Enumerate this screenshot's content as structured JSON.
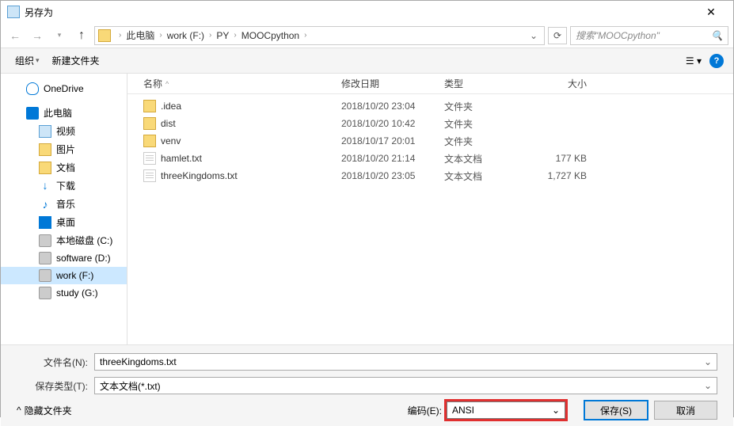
{
  "window": {
    "title": "另存为"
  },
  "breadcrumb": {
    "items": [
      "此电脑",
      "work (F:)",
      "PY",
      "MOOCpython"
    ]
  },
  "search": {
    "placeholder": "搜索\"MOOCpython\""
  },
  "toolbar": {
    "organize": "组织",
    "new_folder": "新建文件夹"
  },
  "sidebar": {
    "items": [
      {
        "label": "OneDrive",
        "icon": "cloud",
        "level": 0
      },
      {
        "label": "此电脑",
        "icon": "pc",
        "level": 0
      },
      {
        "label": "视频",
        "icon": "video",
        "level": 1
      },
      {
        "label": "图片",
        "icon": "folder",
        "level": 1
      },
      {
        "label": "文档",
        "icon": "folder",
        "level": 1
      },
      {
        "label": "下载",
        "icon": "down",
        "level": 1
      },
      {
        "label": "音乐",
        "icon": "music",
        "level": 1
      },
      {
        "label": "桌面",
        "icon": "desktop",
        "level": 1
      },
      {
        "label": "本地磁盘 (C:)",
        "icon": "disk",
        "level": 1
      },
      {
        "label": "software (D:)",
        "icon": "disk",
        "level": 1
      },
      {
        "label": "work (F:)",
        "icon": "disk",
        "level": 1,
        "selected": true
      },
      {
        "label": "study (G:)",
        "icon": "disk",
        "level": 1
      }
    ]
  },
  "columns": {
    "name": "名称",
    "date": "修改日期",
    "type": "类型",
    "size": "大小"
  },
  "files": [
    {
      "name": ".idea",
      "date": "2018/10/20 23:04",
      "type": "文件夹",
      "size": "",
      "kind": "folder"
    },
    {
      "name": "dist",
      "date": "2018/10/20 10:42",
      "type": "文件夹",
      "size": "",
      "kind": "folder"
    },
    {
      "name": "venv",
      "date": "2018/10/17 20:01",
      "type": "文件夹",
      "size": "",
      "kind": "folder"
    },
    {
      "name": "hamlet.txt",
      "date": "2018/10/20 21:14",
      "type": "文本文档",
      "size": "177 KB",
      "kind": "file"
    },
    {
      "name": "threeKingdoms.txt",
      "date": "2018/10/20 23:05",
      "type": "文本文档",
      "size": "1,727 KB",
      "kind": "file"
    }
  ],
  "form": {
    "filename_label": "文件名(N):",
    "filename_value": "threeKingdoms.txt",
    "filetype_label": "保存类型(T):",
    "filetype_value": "文本文档(*.txt)",
    "encoding_label": "编码(E):",
    "encoding_value": "ANSI",
    "hide_folders": "隐藏文件夹",
    "save": "保存(S)",
    "cancel": "取消"
  }
}
